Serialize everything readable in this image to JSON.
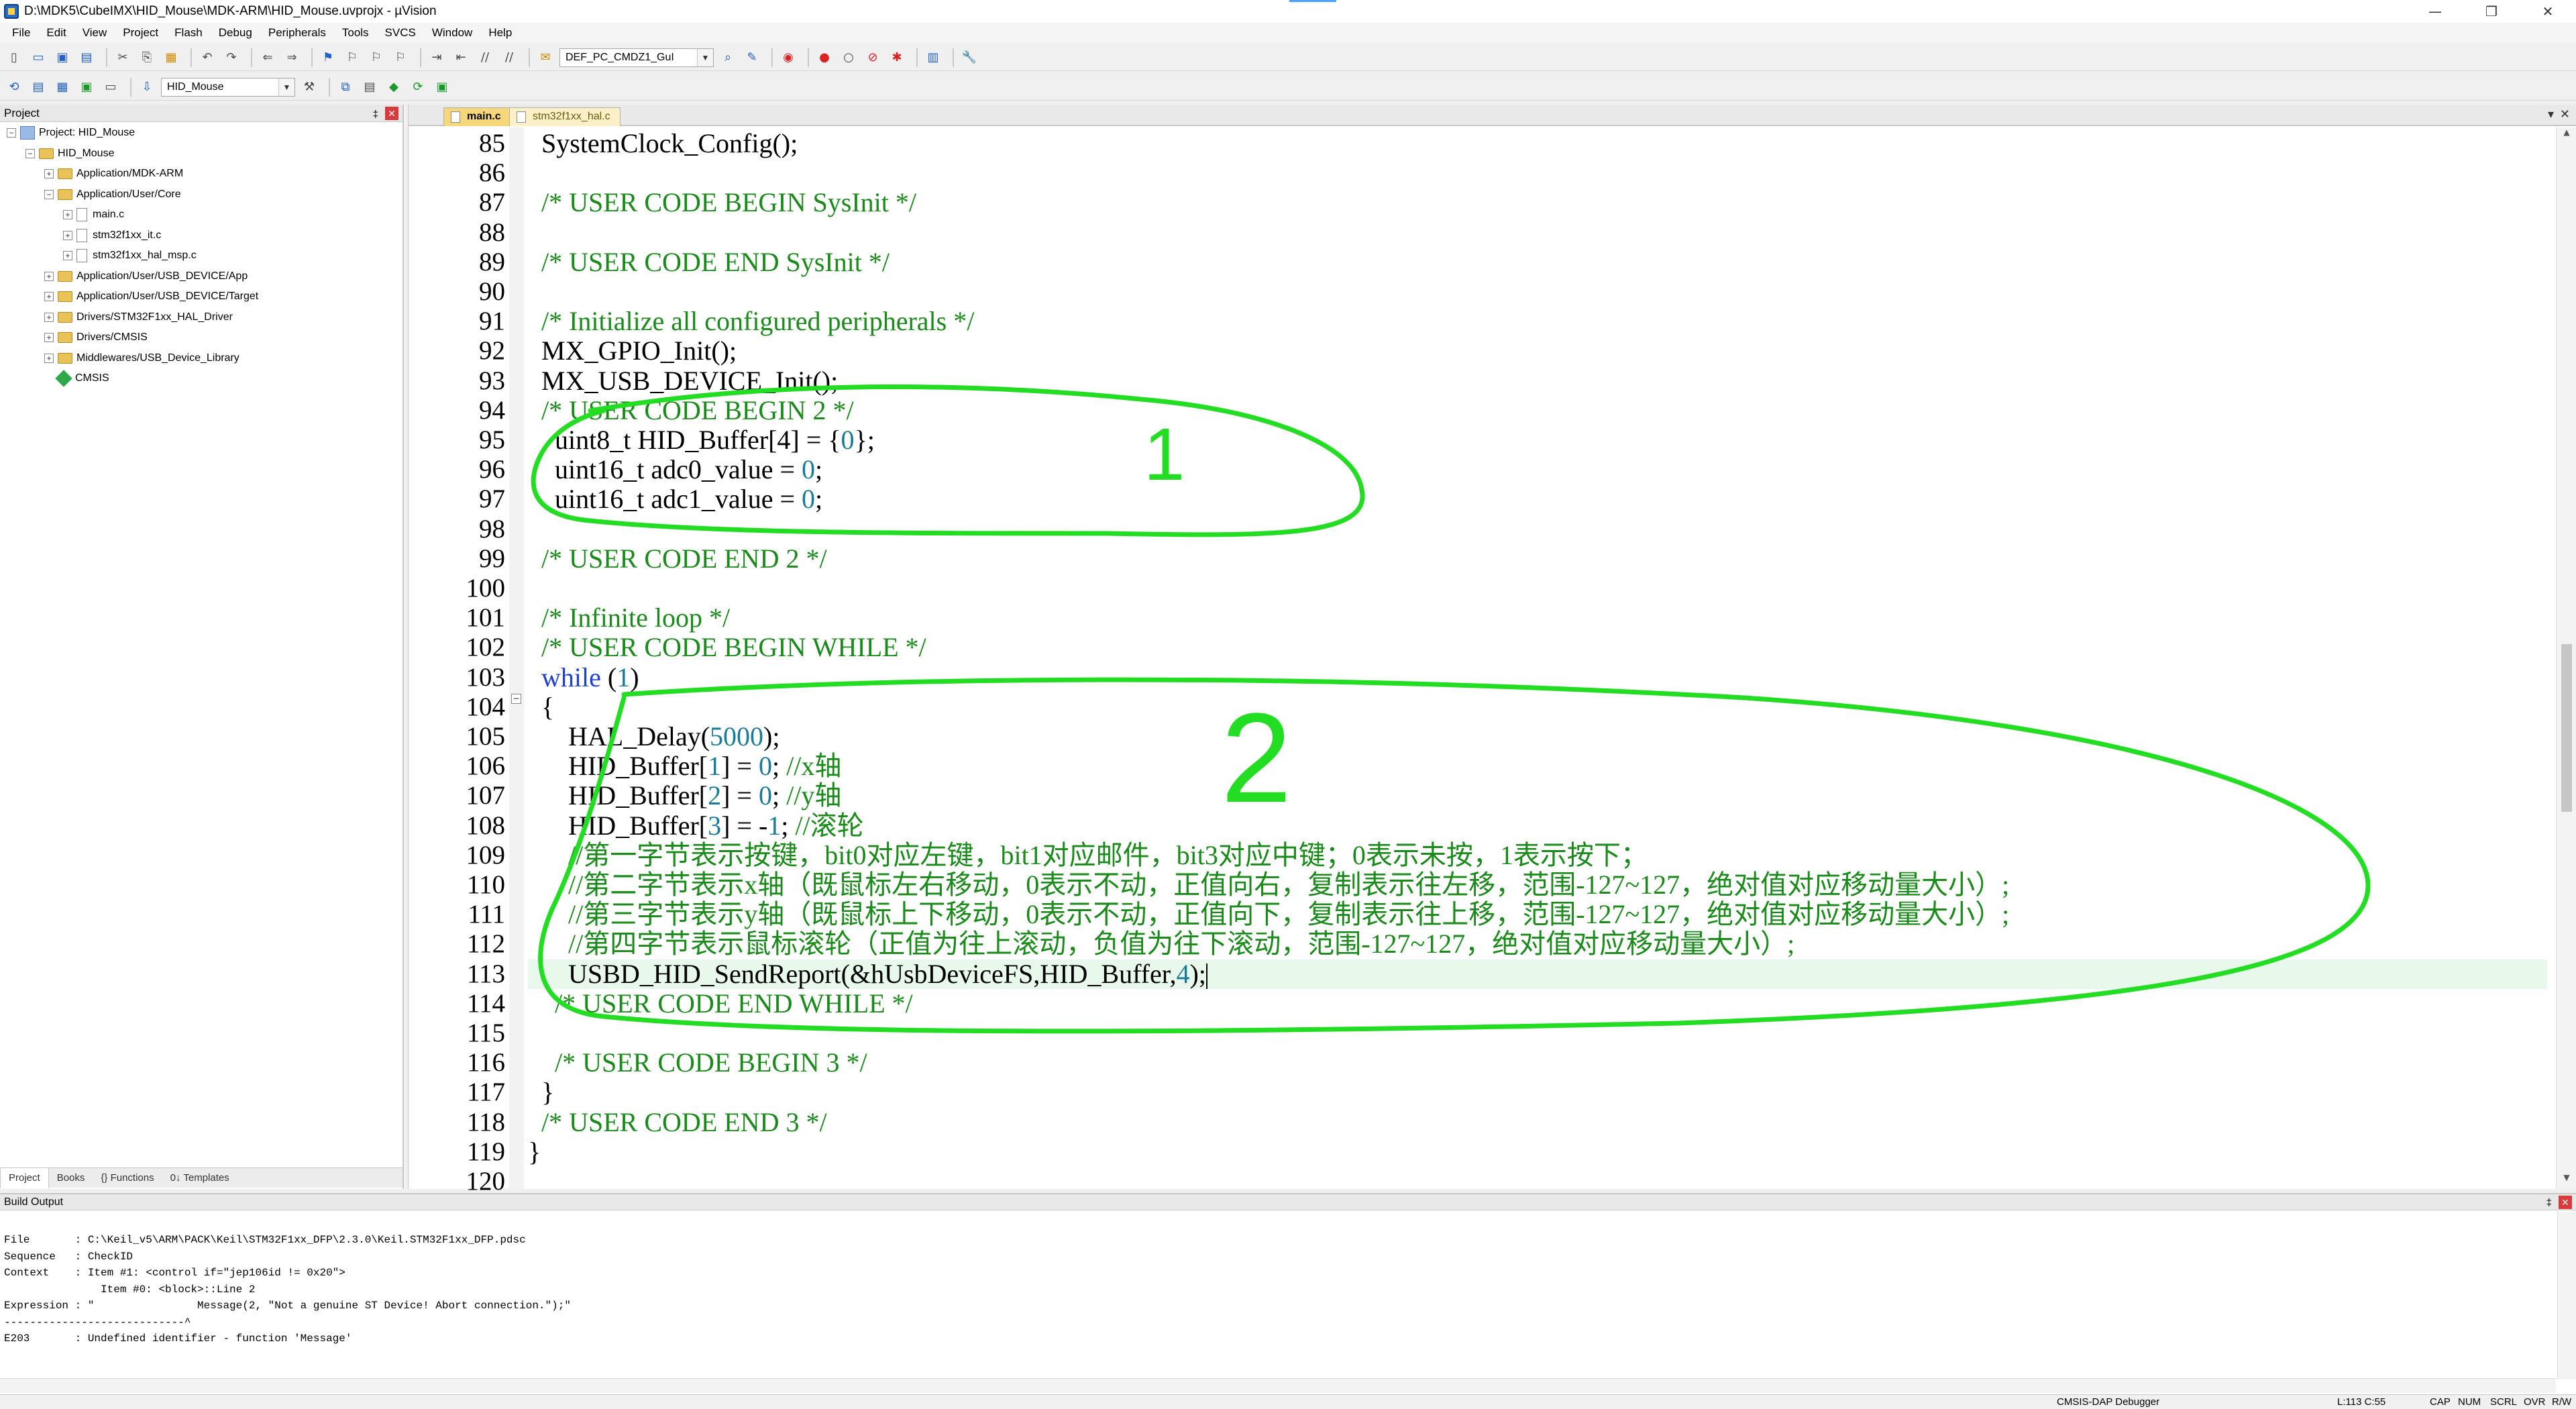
{
  "window": {
    "title": "D:\\MDK5\\CubeIMX\\HID_Mouse\\MDK-ARM\\HID_Mouse.uvprojx - µVision",
    "controls": [
      "—",
      "❐",
      "✕"
    ]
  },
  "menus": [
    "File",
    "Edit",
    "View",
    "Project",
    "Flash",
    "Debug",
    "Peripherals",
    "Tools",
    "SVCS",
    "Window",
    "Help"
  ],
  "toolbar": {
    "device_combo": "DEF_PC_CMDZ1_GuI",
    "target_combo": "HID_Mouse"
  },
  "project_panel": {
    "title": "Project",
    "pin": "‡",
    "close": "✕",
    "tree": [
      {
        "label": "Project: HID_Mouse",
        "depth": 0,
        "kind": "proj",
        "exp": "−"
      },
      {
        "label": "HID_Mouse",
        "depth": 1,
        "kind": "folder",
        "exp": "−"
      },
      {
        "label": "Application/MDK-ARM",
        "depth": 2,
        "kind": "folder",
        "exp": "+"
      },
      {
        "label": "Application/User/Core",
        "depth": 2,
        "kind": "folder",
        "exp": "−"
      },
      {
        "label": "main.c",
        "depth": 3,
        "kind": "file",
        "exp": "+"
      },
      {
        "label": "stm32f1xx_it.c",
        "depth": 3,
        "kind": "file",
        "exp": "+"
      },
      {
        "label": "stm32f1xx_hal_msp.c",
        "depth": 3,
        "kind": "file",
        "exp": "+"
      },
      {
        "label": "Application/User/USB_DEVICE/App",
        "depth": 2,
        "kind": "folder",
        "exp": "+"
      },
      {
        "label": "Application/User/USB_DEVICE/Target",
        "depth": 2,
        "kind": "folder",
        "exp": "+"
      },
      {
        "label": "Drivers/STM32F1xx_HAL_Driver",
        "depth": 2,
        "kind": "folder",
        "exp": "+"
      },
      {
        "label": "Drivers/CMSIS",
        "depth": 2,
        "kind": "folder",
        "exp": "+"
      },
      {
        "label": "Middlewares/USB_Device_Library",
        "depth": 2,
        "kind": "folder",
        "exp": "+"
      },
      {
        "label": "CMSIS",
        "depth": 2,
        "kind": "gem",
        "exp": ""
      }
    ],
    "tabs": [
      "Project",
      "Books",
      "{} Functions",
      "0↓ Templates"
    ]
  },
  "editor": {
    "tabs": [
      {
        "label": "main.c",
        "active": true
      },
      {
        "label": "stm32f1xx_hal.c",
        "active": false
      }
    ],
    "tab_controls": [
      "▾",
      "✕"
    ],
    "line_numbers": [
      "85",
      "86",
      "87",
      "88",
      "89",
      "90",
      "91",
      "92",
      "93",
      "94",
      "95",
      "96",
      "97",
      "98",
      "99",
      "100",
      "101",
      "102",
      "103",
      "104",
      "105",
      "106",
      "107",
      "108",
      "109",
      "110",
      "111",
      "112",
      "113",
      "114",
      "115",
      "116",
      "117",
      "118",
      "119",
      "120"
    ],
    "fold_markers": [
      "−"
    ],
    "lines": [
      [
        [
          "n",
          "  SystemClock_Config();"
        ]
      ],
      [
        [
          "n",
          ""
        ]
      ],
      [
        [
          "c",
          "  /* USER CODE BEGIN SysInit */"
        ]
      ],
      [
        [
          "n",
          ""
        ]
      ],
      [
        [
          "c",
          "  /* USER CODE END SysInit */"
        ]
      ],
      [
        [
          "n",
          ""
        ]
      ],
      [
        [
          "c",
          "  /* Initialize all configured peripherals */"
        ]
      ],
      [
        [
          "n",
          "  MX_GPIO_Init();"
        ]
      ],
      [
        [
          "n",
          "  MX_USB_DEVICE_Init();"
        ]
      ],
      [
        [
          "c",
          "  /* USER CODE BEGIN 2 */"
        ]
      ],
      [
        [
          "n",
          "    uint8_t HID_Buffer[4] = {"
        ],
        [
          "d",
          "0"
        ],
        [
          "n",
          "};"
        ]
      ],
      [
        [
          "n",
          "    uint16_t adc0_value = "
        ],
        [
          "d",
          "0"
        ],
        [
          "n",
          ";"
        ]
      ],
      [
        [
          "n",
          "    uint16_t adc1_value = "
        ],
        [
          "d",
          "0"
        ],
        [
          "n",
          ";"
        ]
      ],
      [
        [
          "n",
          ""
        ]
      ],
      [
        [
          "c",
          "  /* USER CODE END 2 */"
        ]
      ],
      [
        [
          "n",
          ""
        ]
      ],
      [
        [
          "c",
          "  /* Infinite loop */"
        ]
      ],
      [
        [
          "c",
          "  /* USER CODE BEGIN WHILE */"
        ]
      ],
      [
        [
          "k",
          "  while"
        ],
        [
          "n",
          " ("
        ],
        [
          "d",
          "1"
        ],
        [
          "n",
          ")"
        ]
      ],
      [
        [
          "n",
          "  {"
        ]
      ],
      [
        [
          "n",
          "      HAL_Delay("
        ],
        [
          "d",
          "5000"
        ],
        [
          "n",
          ");"
        ]
      ],
      [
        [
          "n",
          "      HID_Buffer["
        ],
        [
          "d",
          "1"
        ],
        [
          "n",
          "] = "
        ],
        [
          "d",
          "0"
        ],
        [
          "n",
          "; "
        ],
        [
          "c",
          "//x轴"
        ]
      ],
      [
        [
          "n",
          "      HID_Buffer["
        ],
        [
          "d",
          "2"
        ],
        [
          "n",
          "] = "
        ],
        [
          "d",
          "0"
        ],
        [
          "n",
          "; "
        ],
        [
          "c",
          "//y轴"
        ]
      ],
      [
        [
          "n",
          "      HID_Buffer["
        ],
        [
          "d",
          "3"
        ],
        [
          "n",
          "] = -"
        ],
        [
          "d",
          "1"
        ],
        [
          "n",
          "; "
        ],
        [
          "c",
          "//滚轮"
        ]
      ],
      [
        [
          "c",
          "      //第一字节表示按键，bit0对应左键，bit1对应邮件，bit3对应中键；0表示未按，1表示按下；"
        ]
      ],
      [
        [
          "c",
          "      //第二字节表示x轴（既鼠标左右移动，0表示不动，正值向右，复制表示往左移，范围-127~127，绝对值对应移动量大小）;"
        ]
      ],
      [
        [
          "c",
          "      //第三字节表示y轴（既鼠标上下移动，0表示不动，正值向下，复制表示往上移，范围-127~127，绝对值对应移动量大小）;"
        ]
      ],
      [
        [
          "c",
          "      //第四字节表示鼠标滚轮（正值为往上滚动，负值为往下滚动，范围-127~127，绝对值对应移动量大小）;"
        ]
      ],
      [
        [
          "n",
          "      USBD_HID_SendReport(&hUsbDeviceFS,HID_Buffer,"
        ],
        [
          "d",
          "4"
        ],
        [
          "n",
          ");"
        ]
      ],
      [
        [
          "c",
          "    /* USER CODE END WHILE */"
        ]
      ],
      [
        [
          "n",
          ""
        ]
      ],
      [
        [
          "c",
          "    /* USER CODE BEGIN 3 */"
        ]
      ],
      [
        [
          "n",
          "  }"
        ]
      ],
      [
        [
          "c",
          "  /* USER CODE END 3 */"
        ]
      ],
      [
        [
          "n",
          "}"
        ]
      ],
      [
        [
          "n",
          ""
        ]
      ]
    ],
    "current_line_index": 28
  },
  "annotations": {
    "color": "#22dd22",
    "labels": [
      "1",
      "2"
    ]
  },
  "build_output": {
    "title": "Build Output",
    "lines": [
      "File       : C:\\Keil_v5\\ARM\\PACK\\Keil\\STM32F1xx_DFP\\2.3.0\\Keil.STM32F1xx_DFP.pdsc",
      "Sequence   : CheckID",
      "Context    : Item #1: <control if=\"jep106id != 0x20\">",
      "               Item #0: <block>::Line 2",
      "Expression : \"                Message(2, \"Not a genuine ST Device! Abort connection.\");\"",
      "----------------------------^",
      "E203       : Undefined identifier - function 'Message'"
    ]
  },
  "status": {
    "debugger": "CMSIS-DAP Debugger",
    "position": "L:113 C:55",
    "indicators": [
      "CAP",
      "NUM",
      "SCRL",
      "OVR",
      "R/W"
    ]
  },
  "colors": {
    "comment": "#1a8a1a",
    "keyword": "#2040d0",
    "number": "#1a7a9a",
    "current_line": "#e8f8ea",
    "active_tab": "#f6d77a"
  }
}
